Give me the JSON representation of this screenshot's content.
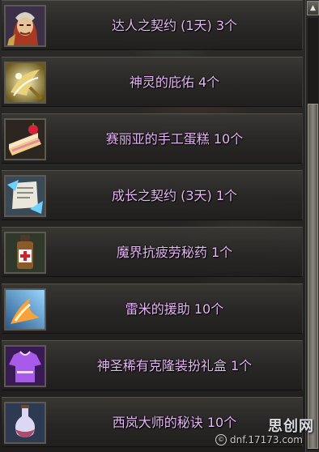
{
  "items": [
    {
      "label": "达人之契约 (1天) 3个",
      "icon": "warrior-portrait-icon"
    },
    {
      "label": "神灵的庇佑 4个",
      "icon": "golden-blessing-icon"
    },
    {
      "label": "赛丽亚的手工蛋糕 10个",
      "icon": "cake-icon"
    },
    {
      "label": "成长之契约 (3天) 1个",
      "icon": "contract-scroll-icon"
    },
    {
      "label": "魔界抗疲劳秘药 1个",
      "icon": "medicine-bottle-icon"
    },
    {
      "label": "雷米的援助 10个",
      "icon": "flame-aid-icon"
    },
    {
      "label": "神圣稀有克隆装扮礼盒 1个",
      "icon": "purple-outfit-box-icon"
    },
    {
      "label": "西岚大师的秘诀 10个",
      "icon": "potion-flask-icon"
    }
  ],
  "scrollbar": {
    "up_arrow": "▲"
  },
  "watermark": {
    "url": "dnf.17173.com",
    "logo": "思创网",
    "circle_mark": "©"
  },
  "colors": {
    "label_text": "#e6b7f5",
    "row_bg": "#302e2b",
    "background": "#1b1a19"
  }
}
